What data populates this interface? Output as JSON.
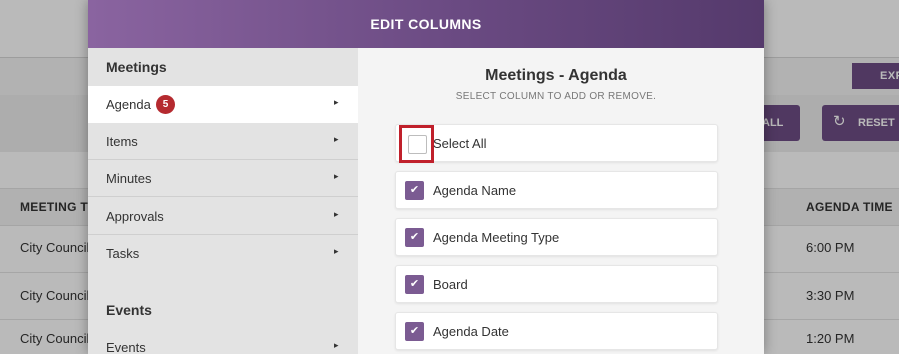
{
  "background": {
    "export_button": "EXP",
    "all_button": "ALL",
    "reset_button": "RESET",
    "reset_icon": "refresh-icon",
    "table": {
      "col_left": "MEETING TY",
      "col_right": "AGENDA TIME",
      "rows": [
        {
          "left": "City Council",
          "right": "6:00 PM"
        },
        {
          "left": "City Council",
          "right": "3:30 PM"
        },
        {
          "left": "City Council",
          "right": "1:20 PM"
        }
      ]
    }
  },
  "modal": {
    "title": "EDIT COLUMNS",
    "sidebar": {
      "section_meetings": "Meetings",
      "items": [
        {
          "label": "Agenda",
          "badge": "5"
        },
        {
          "label": "Items"
        },
        {
          "label": "Minutes"
        },
        {
          "label": "Approvals"
        },
        {
          "label": "Tasks"
        }
      ],
      "section_events": "Events",
      "event_items": [
        {
          "label": "Events"
        }
      ],
      "chevron": "▸"
    },
    "content": {
      "title": "Meetings - Agenda",
      "subtitle": "SELECT COLUMN TO ADD OR REMOVE.",
      "select_all": "Select All",
      "options": [
        {
          "label": "Agenda Name",
          "checked": true
        },
        {
          "label": "Agenda Meeting Type",
          "checked": true
        },
        {
          "label": "Board",
          "checked": true
        },
        {
          "label": "Agenda Date",
          "checked": true
        }
      ],
      "check_glyph": "✔"
    },
    "colors": {
      "header": "#6a4a82",
      "checkbox": "#7b5b92",
      "badge": "#b52a2f",
      "highlight": "#c0202b"
    }
  }
}
